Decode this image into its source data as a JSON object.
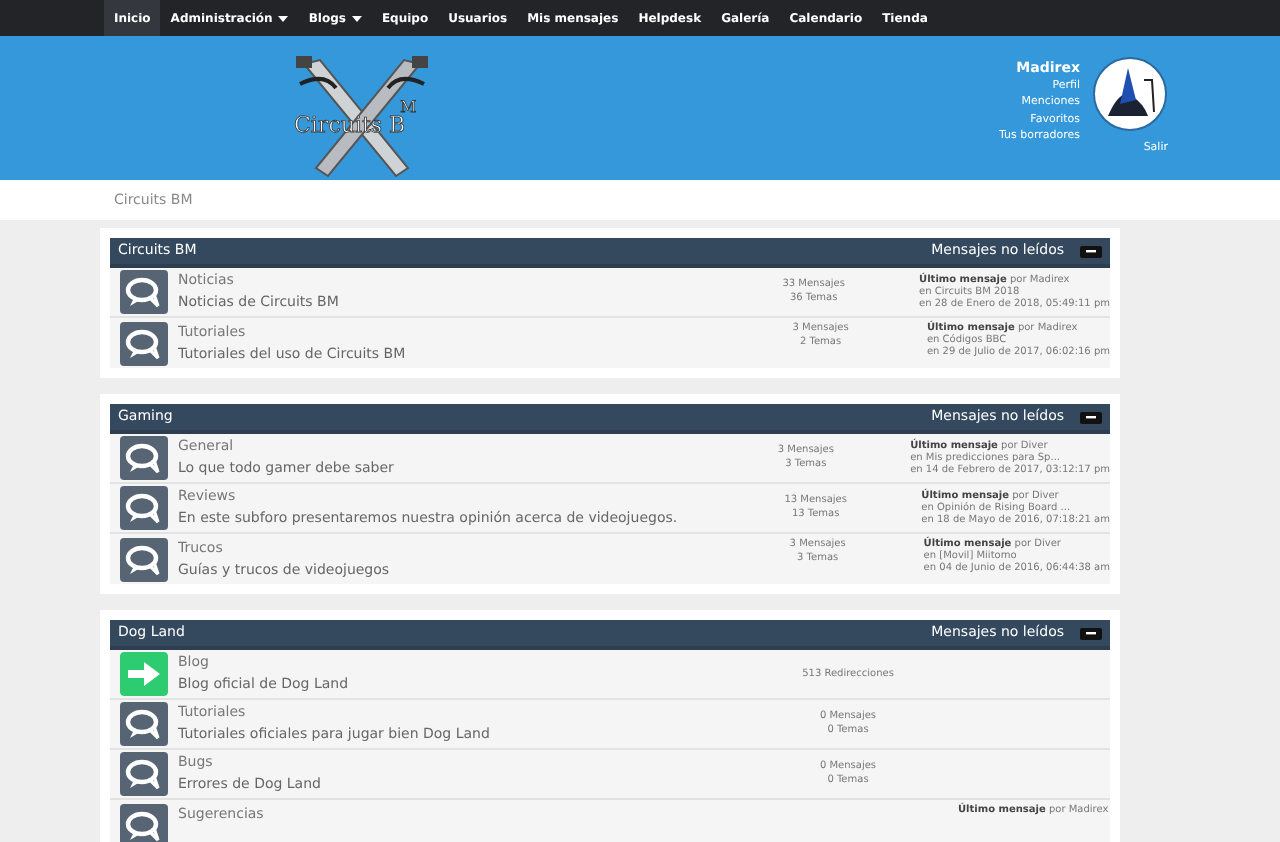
{
  "nav": [
    {
      "label": "Inicio",
      "selected": true,
      "dropdown": false
    },
    {
      "label": "Administración",
      "selected": false,
      "dropdown": true
    },
    {
      "label": "Blogs",
      "selected": false,
      "dropdown": true
    },
    {
      "label": "Equipo",
      "selected": false,
      "dropdown": false
    },
    {
      "label": "Usuarios",
      "selected": false,
      "dropdown": false
    },
    {
      "label": "Mis mensajes",
      "selected": false,
      "dropdown": false
    },
    {
      "label": "Helpdesk",
      "selected": false,
      "dropdown": false
    },
    {
      "label": "Galería",
      "selected": false,
      "dropdown": false
    },
    {
      "label": "Calendario",
      "selected": false,
      "dropdown": false
    },
    {
      "label": "Tienda",
      "selected": false,
      "dropdown": false
    }
  ],
  "logo": {
    "text": "Circuits B",
    "superscript": "M"
  },
  "user": {
    "name": "Madirex",
    "links": [
      "Perfil",
      "Menciones",
      "Favoritos",
      "Tus borradores"
    ],
    "logout": "Salir"
  },
  "breadcrumb": "Circuits BM",
  "categories": [
    {
      "title": "Circuits BM",
      "unread": "Mensajes no leídos",
      "boards": [
        {
          "kind": "board",
          "name": "Noticias",
          "description": "Noticias de Circuits BM",
          "stats": [
            "33 Mensajes",
            "36 Temas"
          ],
          "last_post": [
            "**Último mensaje** por Madirex",
            "en Circuits BM 2018",
            "en 28 de Enero de 2018, 05:49:11 pm"
          ]
        },
        {
          "kind": "board",
          "name": "Tutoriales",
          "description": "Tutoriales del uso de Circuits BM",
          "stats": [
            "3 Mensajes",
            "2 Temas"
          ],
          "last_post": [
            "**Último mensaje** por Madirex",
            "en Códigos BBC",
            "en 29 de Julio de 2017, 06:02:16 pm"
          ]
        }
      ]
    },
    {
      "title": "Gaming",
      "unread": "Mensajes no leídos",
      "boards": [
        {
          "kind": "board",
          "name": "General",
          "description": "Lo que todo gamer debe saber",
          "stats": [
            "3 Mensajes",
            "3 Temas"
          ],
          "last_post": [
            "**Último mensaje** por Diver",
            "en Mis predicciones para Sp...",
            "en 14 de Febrero de 2017, 03:12:17 pm"
          ]
        },
        {
          "kind": "board",
          "name": "Reviews",
          "description": "En este subforo presentaremos nuestra opinión acerca de videojuegos.",
          "stats": [
            "13 Mensajes",
            "13 Temas"
          ],
          "last_post": [
            "**Último mensaje** por Diver",
            "en Opinión de Rising Board ...",
            "en 18 de Mayo de 2016, 07:18:21 am"
          ]
        },
        {
          "kind": "board",
          "name": "Trucos",
          "description": "Guías y trucos de videojuegos",
          "stats": [
            "3 Mensajes",
            "3 Temas"
          ],
          "last_post": [
            "**Último mensaje** por Diver",
            "en [Movil] Miitomo",
            "en 04 de Junio de 2016, 06:44:38 am"
          ]
        }
      ]
    },
    {
      "title": "Dog Land",
      "unread": "Mensajes no leídos",
      "boards": [
        {
          "kind": "redirect",
          "name": "Blog",
          "description": "Blog oficial de Dog Land",
          "stats": [
            "513 Redirecciones"
          ]
        },
        {
          "kind": "board",
          "name": "Tutoriales",
          "description": "Tutoriales oficiales para jugar bien Dog Land",
          "stats": [
            "0 Mensajes",
            "0 Temas"
          ]
        },
        {
          "kind": "board",
          "name": "Bugs",
          "description": "Errores de Dog Land",
          "stats": [
            "0 Mensajes",
            "0 Temas"
          ]
        },
        {
          "kind": "board",
          "name": "Sugerencias",
          "last_post": [
            "**Último mensaje** por Madirex"
          ]
        }
      ]
    }
  ]
}
